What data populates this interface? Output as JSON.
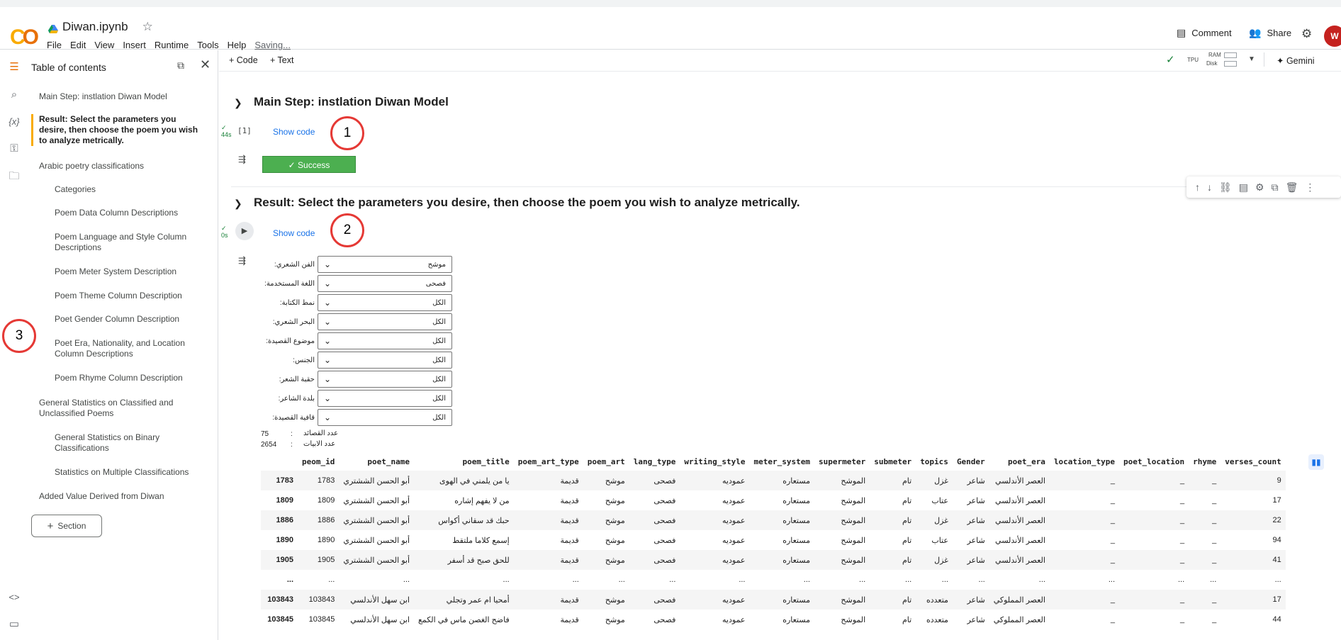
{
  "app": {
    "name": "Colab",
    "notebook_title": "Diwan.ipynb",
    "saving": "Saving..."
  },
  "menu": [
    "File",
    "Edit",
    "View",
    "Insert",
    "Runtime",
    "Tools",
    "Help"
  ],
  "header_actions": {
    "comment": "Comment",
    "share": "Share",
    "avatar_letter": "W"
  },
  "toolbar": {
    "add_code": "+ Code",
    "add_text": "+ Text",
    "runtime": "TPU",
    "ram": "RAM",
    "disk": "Disk",
    "gemini": "Gemini"
  },
  "toc": {
    "title": "Table of contents",
    "items": [
      "Main Step: instlation Diwan Model",
      "Result: Select the parameters you desire, then choose the poem you wish to analyze metrically.",
      "Arabic poetry classifications",
      "Categories",
      "Poem Data Column Descriptions",
      "Poem Language and Style Column Descriptions",
      "Poem Meter System Description",
      "Poem Theme Column Description",
      "Poet Gender Column Description",
      "Poet Era, Nationality, and Location Column Descriptions",
      "Poem Rhyme Column Description",
      "General Statistics on Classified and Unclassified Poems",
      "General Statistics on Binary Classifications",
      "Statistics on Multiple Classifications",
      "Added Value Derived from Diwan"
    ],
    "section_button": "Section"
  },
  "annotations": [
    "1",
    "2",
    "3"
  ],
  "cell1": {
    "heading": "Main Step: instlation Diwan Model",
    "exec_count": "[1]",
    "exec_time": "44s",
    "show_code": "Show code",
    "success": "✓ Success"
  },
  "cell2": {
    "heading": "Result: Select the parameters you desire, then choose the poem you wish to analyze metrically.",
    "exec_time": "0s",
    "show_code": "Show code"
  },
  "filters": [
    {
      "label": ":الفن الشعري",
      "value": "موشح"
    },
    {
      "label": ":اللغة المستخدمة",
      "value": "فصحى"
    },
    {
      "label": ":نمط الكتابة",
      "value": "الكل"
    },
    {
      "label": ":البحر الشعري",
      "value": "الكل"
    },
    {
      "label": ":موضوع القصيدة",
      "value": "الكل"
    },
    {
      "label": ":الجنس",
      "value": "الكل"
    },
    {
      "label": ":حقبة الشعر",
      "value": "الكل"
    },
    {
      "label": ":بلدة الشاعر",
      "value": "الكل"
    },
    {
      "label": ":قافية القصيدة",
      "value": "الكل"
    }
  ],
  "stats": [
    {
      "label": "عدد القصائد",
      "value": "75"
    },
    {
      "label": "عدد الابيات",
      "value": "2654"
    }
  ],
  "table": {
    "columns": [
      "peom_id",
      "poet_name",
      "poem_title",
      "poem_art_type",
      "poem_art",
      "lang_type",
      "writing_style",
      "meter_system",
      "supermeter",
      "submeter",
      "topics",
      "Gender",
      "poet_era",
      "location_type",
      "poet_location",
      "rhyme",
      "verses_count"
    ],
    "rows": [
      [
        "1783",
        "1783",
        "أبو الحسن الششتري",
        "يا من يلمني في الهوى",
        "قديمة",
        "موشح",
        "فصحى",
        "عموديه",
        "مستعاره",
        "الموشح",
        "تام",
        "غزل",
        "شاعر",
        "العصر الأندلسي",
        "_",
        "_",
        "_",
        "9"
      ],
      [
        "1809",
        "1809",
        "أبو الحسن الششتري",
        "من لا يفهم إشاره",
        "قديمة",
        "موشح",
        "فصحى",
        "عموديه",
        "مستعاره",
        "الموشح",
        "تام",
        "عتاب",
        "شاعر",
        "العصر الأندلسي",
        "_",
        "_",
        "_",
        "17"
      ],
      [
        "1886",
        "1886",
        "أبو الحسن الششتري",
        "حبك قد سقاني أكواس",
        "قديمة",
        "موشح",
        "فصحى",
        "عموديه",
        "مستعاره",
        "الموشح",
        "تام",
        "غزل",
        "شاعر",
        "العصر الأندلسي",
        "_",
        "_",
        "_",
        "22"
      ],
      [
        "1890",
        "1890",
        "أبو الحسن الششتري",
        "إسمع كلاما ملتقط",
        "قديمة",
        "موشح",
        "فصحى",
        "عموديه",
        "مستعاره",
        "الموشح",
        "تام",
        "عتاب",
        "شاعر",
        "العصر الأندلسي",
        "_",
        "_",
        "_",
        "94"
      ],
      [
        "1905",
        "1905",
        "أبو الحسن الششتري",
        "للحق صبح قد أسفر",
        "قديمة",
        "موشح",
        "فصحى",
        "عموديه",
        "مستعاره",
        "الموشح",
        "تام",
        "غزل",
        "شاعر",
        "العصر الأندلسي",
        "_",
        "_",
        "_",
        "41"
      ],
      [
        "...",
        "...",
        "...",
        "...",
        "...",
        "...",
        "...",
        "...",
        "...",
        "...",
        "...",
        "...",
        "...",
        "...",
        "...",
        "...",
        "...",
        "..."
      ],
      [
        "103843",
        "103843",
        "ابن سهل الأندلسي",
        "أمحيا ام عمر وتجلي",
        "قديمة",
        "موشح",
        "فصحى",
        "عموديه",
        "مستعاره",
        "الموشح",
        "تام",
        "متعدده",
        "شاعر",
        "العصر المملوكي",
        "_",
        "_",
        "_",
        "17"
      ],
      [
        "103845",
        "103845",
        "ابن سهل الأندلسي",
        "فاضح الغصن ماس في الكمع",
        "قديمة",
        "موشح",
        "فصحى",
        "عموديه",
        "مستعاره",
        "الموشح",
        "تام",
        "متعدده",
        "شاعر",
        "العصر المملوكي",
        "_",
        "_",
        "_",
        "44"
      ]
    ]
  }
}
